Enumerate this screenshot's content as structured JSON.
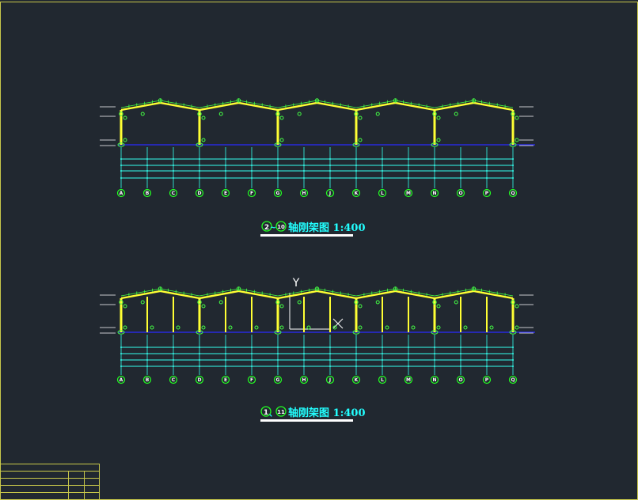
{
  "drawing": {
    "colors": {
      "background": "#212830",
      "border": "#c8c84a",
      "frame": "#ffff33",
      "purlin": "#44ff44",
      "ground": "#2a2aff",
      "grid": "#33ffee",
      "axis_bubble": "#22ff22",
      "title_text": "#22ffff",
      "white": "#ffffff"
    },
    "axis_labels": [
      "A",
      "B",
      "C",
      "D",
      "E",
      "F",
      "G",
      "H",
      "J",
      "K",
      "L",
      "M",
      "N",
      "O",
      "P",
      "Q"
    ],
    "ucs": {
      "label": "Y"
    },
    "frames": [
      {
        "id": "frame-upper",
        "title": {
          "from": "2",
          "sep": "~",
          "to": "10",
          "text": "轴刚架图 1:400"
        },
        "interior_columns": false
      },
      {
        "id": "frame-lower",
        "title": {
          "from": "1",
          "sep": "、",
          "to": "11",
          "text": "轴刚架图 1:400"
        },
        "interior_columns": true
      }
    ]
  }
}
